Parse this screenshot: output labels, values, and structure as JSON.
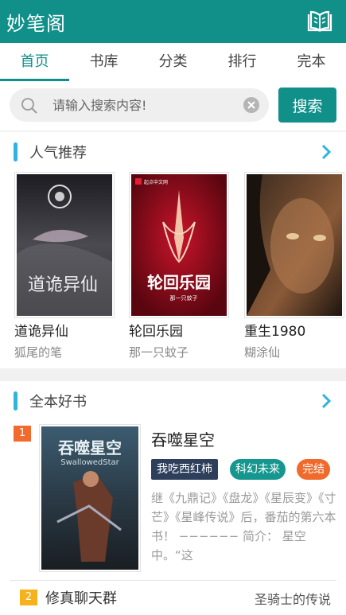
{
  "app": {
    "title": "妙笔阁",
    "bookshelf_icon": "open-book-icon"
  },
  "tabs": [
    {
      "label": "首页",
      "active": true
    },
    {
      "label": "书库",
      "active": false
    },
    {
      "label": "分类",
      "active": false
    },
    {
      "label": "排行",
      "active": false
    },
    {
      "label": "完本",
      "active": false
    }
  ],
  "search": {
    "placeholder": "请输入搜索内容!",
    "value": "",
    "button_label": "搜索"
  },
  "popular": {
    "title": "人气推荐",
    "books": [
      {
        "name": "道诡异仙",
        "author": "狐尾的笔",
        "cover_text": "道诡异仙"
      },
      {
        "name": "轮回乐园",
        "author": "那一只蚊子",
        "cover_text": "轮回乐园",
        "cover_publisher": "起点中文网"
      },
      {
        "name": "重生1980",
        "author": "糊涂仙"
      }
    ]
  },
  "completed": {
    "title": "全本好书",
    "featured": {
      "rank": "1",
      "title": "吞噬星空",
      "author": "我吃西红柿",
      "genre": "科幻未来",
      "status": "完结",
      "description": "继《九鼎记》《盘龙》《星辰变》《寸芒》《星峰传说》后，番茄的第六本书！ −−−−−− 简介： 星空中。“这",
      "cover_text": "吞噬星空",
      "cover_subtext": "SwallowedStar"
    },
    "list": [
      {
        "rank": "2",
        "title": "修真聊天群",
        "author": "圣骑士的传说"
      }
    ]
  },
  "colors": {
    "brand": "#11908a",
    "accent_bar": "#2fb3df",
    "rank_1": "#f26b2c",
    "rank_2": "#f5b21c",
    "tag_author": "#2e3f5c",
    "tag_genre": "#15978f",
    "tag_status": "#f06a2b"
  }
}
